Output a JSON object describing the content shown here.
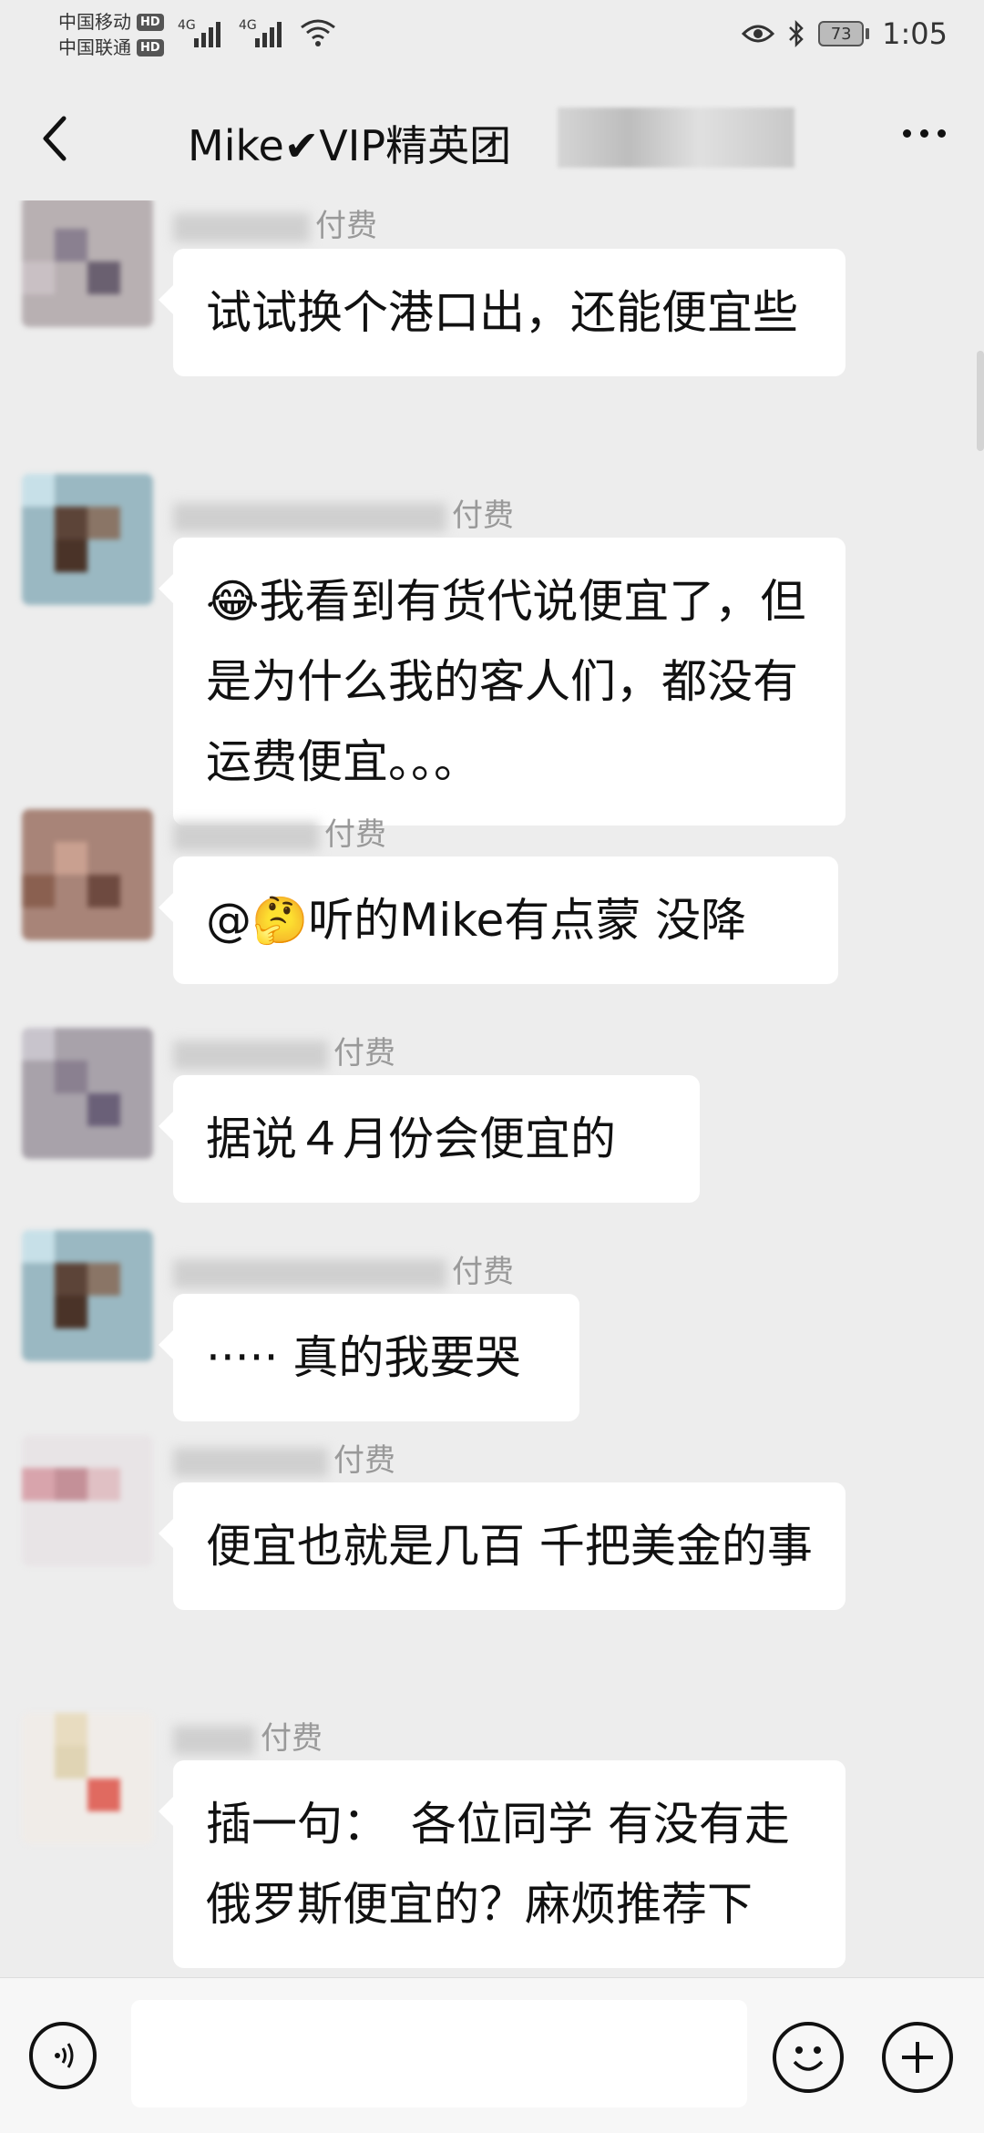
{
  "status_bar": {
    "carrier_1": "中国移动",
    "carrier_2": "中国联通",
    "hd_label": "HD",
    "network_1": "4G",
    "network_2": "4G",
    "battery_level": "73",
    "time": "1:05",
    "icons": [
      "eye-icon",
      "bluetooth-icon",
      "wifi-icon",
      "battery-icon"
    ]
  },
  "nav": {
    "title": "Mike✔VIP精英团",
    "icons": [
      "back-icon",
      "more-icon"
    ]
  },
  "messages": [
    {
      "sender_suffix": "付费",
      "text": "试试换个港口出，还能便宜些"
    },
    {
      "sender_suffix": "付费",
      "text": "😂我看到有货代说便宜了，但是为什么我的客人们，都没有运费便宜。。。"
    },
    {
      "sender_suffix": "付费",
      "text": "@🤔听的Mike有点蒙 没降"
    },
    {
      "sender_suffix": "付费",
      "text": "据说４月份会便宜的"
    },
    {
      "sender_suffix": "付费",
      "text": "····· 真的我要哭"
    },
    {
      "sender_suffix": "付费",
      "text": "便宜也就是几百 千把美金的事"
    },
    {
      "sender_suffix": "付费",
      "text": "插一句：　各位同学 有没有走俄罗斯便宜的？麻烦推荐下"
    }
  ],
  "input_bar": {
    "placeholder": "",
    "icons": [
      "voice-icon",
      "emoji-icon",
      "add-icon"
    ]
  },
  "colors": {
    "background": "#ededed",
    "bubble": "#ffffff",
    "sender_text": "#999999"
  }
}
